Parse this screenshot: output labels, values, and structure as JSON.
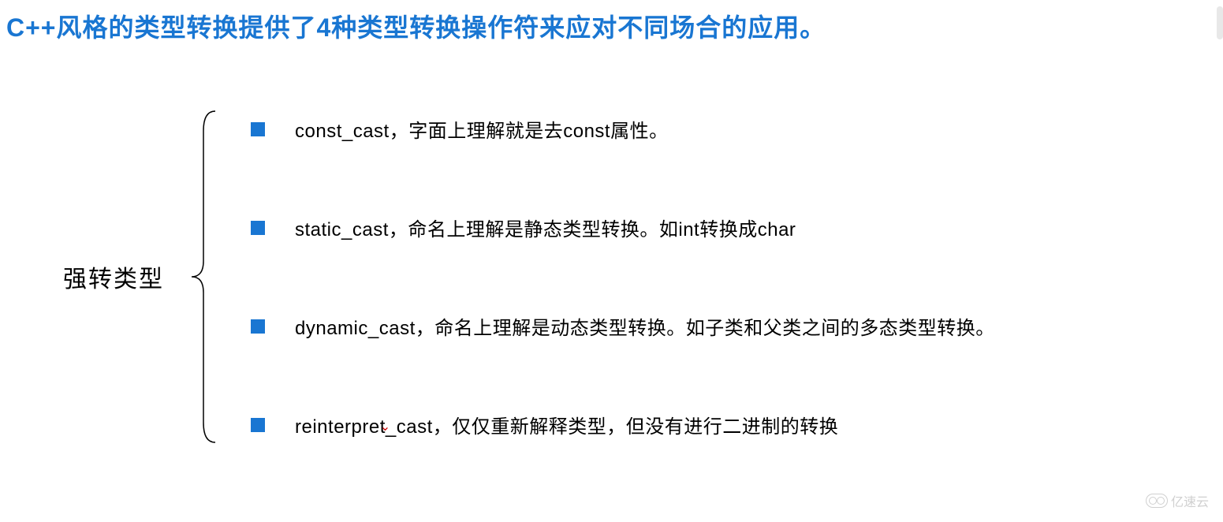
{
  "title": "C++风格的类型转换提供了4种类型转换操作符来应对不同场合的应用。",
  "label": "强转类型",
  "items": [
    {
      "text": "const_cast，字面上理解就是去const属性。"
    },
    {
      "text_pre": "static_cast，命名上理解是静态类型转换。如int转换成char",
      "mark": ""
    },
    {
      "text": "dynamic_cast，命名上理解是动态类型转换。如子类和父类之间的多态类型转换。"
    },
    {
      "text_pre": "reinterpre",
      "mark": "t",
      "text_post": "_cast，仅仅重新解释类型，但没有进行二进制的转换"
    }
  ],
  "watermark": "亿速云"
}
